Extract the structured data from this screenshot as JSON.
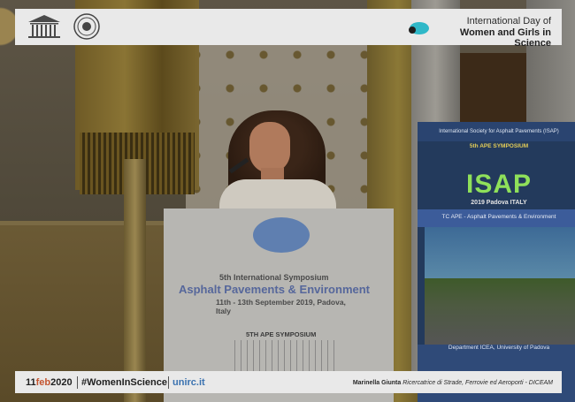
{
  "header": {
    "title_line1": "International Day of",
    "title_line2": "Women and Girls in Science",
    "unesco_logo": "UNESCO",
    "seal_icon": "university-seal-icon"
  },
  "podium": {
    "line1": "5th International Symposium",
    "line2": "Asphalt Pavements & Environment",
    "line3": "11th - 13th September 2019, Padova, Italy",
    "line4": "5TH APE SYMPOSIUM"
  },
  "banner": {
    "t1": "International Society for Asphalt Pavements (ISAP)",
    "t2": "5th APE SYMPOSIUM",
    "isap": "ISAP",
    "t3": "2019 Padova ITALY",
    "t4": "TC APE - Asphalt Pavements & Environment",
    "t5": "Department ICEA, University of Padova"
  },
  "footer": {
    "date_day": "11",
    "date_month": "feb",
    "date_year": "2020",
    "hashtag": "#WomenInScience",
    "site": "unirc.it",
    "credit_name": "Marinella Giunta",
    "credit_role": "Ricercatrice di Strade, Ferrovie ed Aeroporti - DICEAM"
  },
  "colors": {
    "bar_bg": "#e9e9e9",
    "accent_orange": "#c4542f",
    "accent_blue": "#3a72b0",
    "isap_green": "#8fe05a"
  }
}
